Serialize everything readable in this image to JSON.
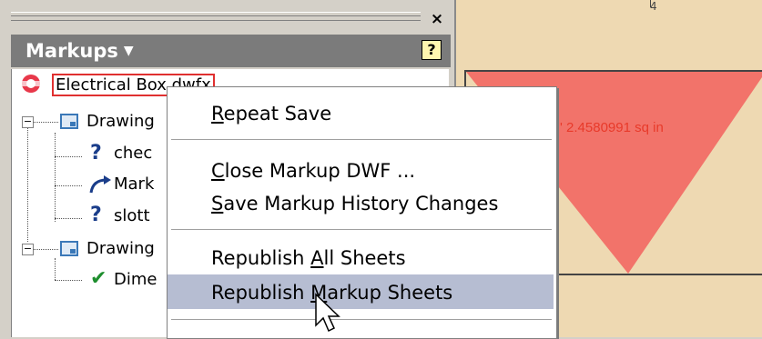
{
  "panel": {
    "close_glyph": "×",
    "title": "Markups",
    "title_caret": "▼",
    "help_glyph": "?"
  },
  "tree": {
    "root_label": "Electrical Box.dwfx",
    "sheet1_label": "Drawing",
    "sheet1_items": [
      "chec",
      "Mark",
      "slott"
    ],
    "sheet2_label": "Drawing",
    "sheet2_items": [
      "Dime"
    ]
  },
  "canvas": {
    "ruler_tick": "4",
    "area_label": "2.4580991 sq in",
    "area_prefix": "'",
    "triangle_color": "#f2736a",
    "background_color": "#eed9b2"
  },
  "menu": {
    "repeat_save": {
      "pre": "",
      "key": "R",
      "post": "epeat Save"
    },
    "close_markup": {
      "pre": "",
      "key": "C",
      "post": "lose Markup DWF ..."
    },
    "save_history": {
      "pre": "",
      "key": "S",
      "post": "ave Markup History Changes"
    },
    "republish_all": {
      "pre": "Republish ",
      "key": "A",
      "post": "ll Sheets"
    },
    "republish_markup": {
      "pre": "Republish ",
      "key": "M",
      "post": "arkup Sheets"
    },
    "active_color": "#b6bdd2"
  }
}
